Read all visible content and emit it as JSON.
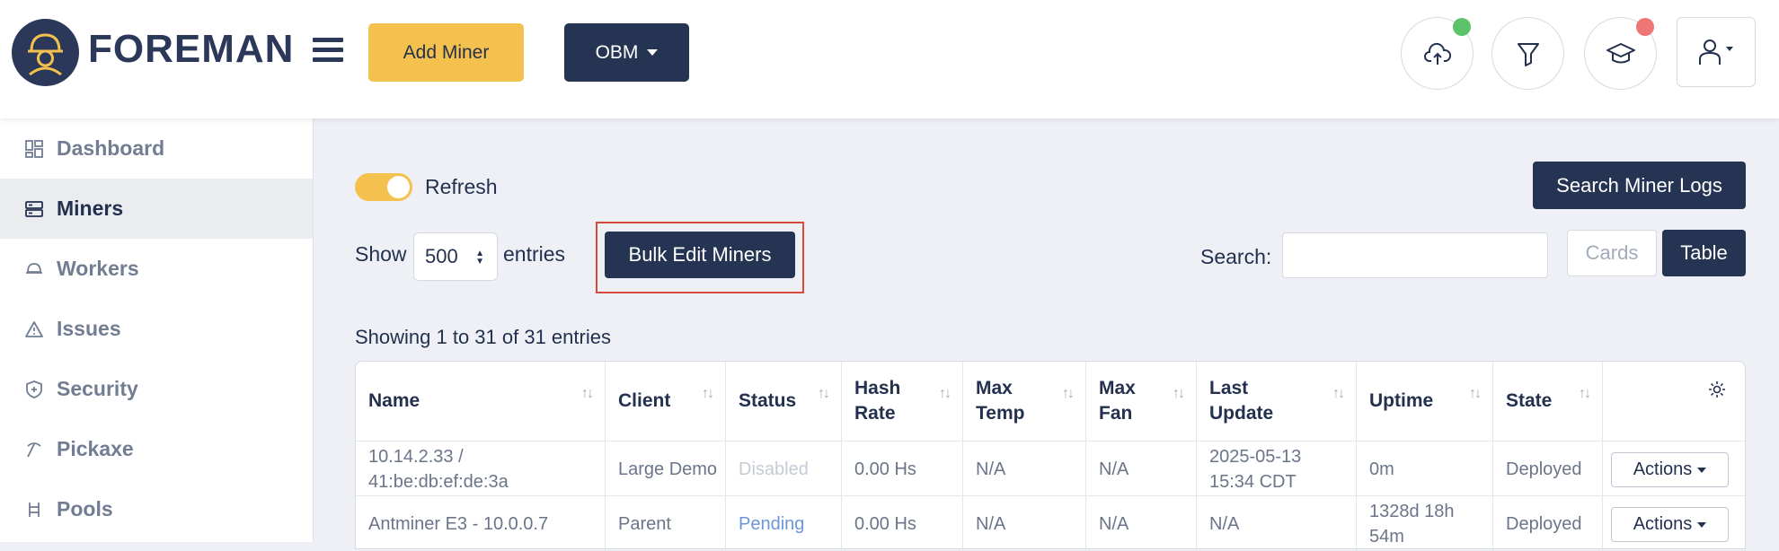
{
  "brand": "FOREMAN",
  "header": {
    "add_miner": "Add Miner",
    "obm": "OBM"
  },
  "colors": {
    "navy": "#253452",
    "accent": "#f4c14e",
    "online": "#5cc36b",
    "alert": "#ef7676"
  },
  "icons": [
    "cloud-upload-icon",
    "filter-icon",
    "graduation-cap-icon",
    "user-icon"
  ],
  "sidebar": {
    "items": [
      {
        "label": "Dashboard",
        "icon": "dashboard-icon"
      },
      {
        "label": "Miners",
        "icon": "server-icon"
      },
      {
        "label": "Workers",
        "icon": "hard-hat-icon"
      },
      {
        "label": "Issues",
        "icon": "warning-icon"
      },
      {
        "label": "Security",
        "icon": "shield-icon"
      },
      {
        "label": "Pickaxe",
        "icon": "pickaxe-icon"
      },
      {
        "label": "Pools",
        "icon": "pools-icon"
      }
    ]
  },
  "main": {
    "refresh_label": "Refresh",
    "search_logs": "Search Miner Logs",
    "show": "Show",
    "page_size": "500",
    "entries": "entries",
    "bulk_edit": "Bulk Edit Miners",
    "search_label": "Search:",
    "search_value": "",
    "cards": "Cards",
    "table": "Table",
    "showing": "Showing 1 to 31 of 31 entries"
  },
  "table": {
    "columns": [
      "Name",
      "Client",
      "Status",
      "Hash Rate",
      "Max Temp",
      "Max Fan",
      "Last Update",
      "Uptime",
      "State"
    ],
    "rows": [
      [
        "10.14.2.33 / 41:be:db:ef:de:3a",
        "Large Demo",
        "Disabled",
        "0.00 Hs",
        "N/A",
        "N/A",
        "2025-05-13 15:34 CDT",
        "0m",
        "Deployed"
      ],
      [
        "Antminer E3 - 10.0.0.7",
        "Parent",
        "Pending",
        "0.00 Hs",
        "N/A",
        "N/A",
        "N/A",
        "1328d 18h 54m",
        "Deployed"
      ]
    ],
    "actions": "Actions"
  }
}
